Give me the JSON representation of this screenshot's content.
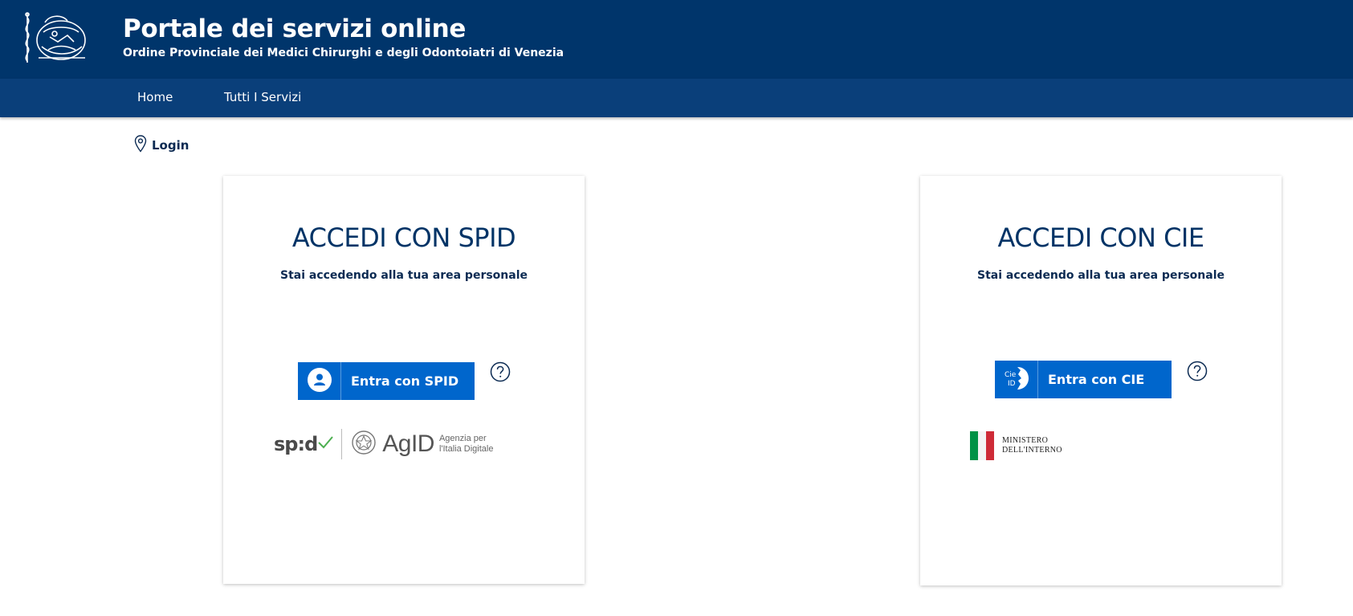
{
  "header": {
    "title": "Portale dei servizi online",
    "subtitle": "Ordine Provinciale dei Medici Chirurghi e degli Odontoiatri di Venezia",
    "logo_icon": "order-crest-icon"
  },
  "nav": {
    "items": [
      {
        "label": "Home"
      },
      {
        "label": "Tutti I Servizi"
      }
    ]
  },
  "breadcrumb": {
    "icon": "location-pin-icon",
    "label": "Login"
  },
  "spid": {
    "title": "ACCEDI CON SPID",
    "description": "Stai accedendo alla tua area personale",
    "button_label": "Entra con SPID",
    "button_icon": "user-icon",
    "help_icon": "question-circle-icon",
    "logo_text": "sp:d",
    "agid_text": "AgID",
    "agid_line1": "Agenzia per",
    "agid_line2": "l'Italia Digitale"
  },
  "cie": {
    "title": "ACCEDI CON CIE",
    "description": "Stai accedendo alla tua area personale",
    "button_label": "Entra con CIE",
    "button_icon": "cie-id-icon",
    "cie_icon_line1": "Cie",
    "cie_icon_line2": "ID",
    "help_icon": "question-circle-icon",
    "ministero_line1": "MINISTERO",
    "ministero_line2": "DELL'INTERNO"
  },
  "colors": {
    "header_bg": "#00356b",
    "nav_bg": "#0a3f7a",
    "button_bg": "#0066cc",
    "title_text": "#003366",
    "flag_green": "#009246",
    "flag_white": "#ffffff",
    "flag_red": "#ce2b37"
  }
}
